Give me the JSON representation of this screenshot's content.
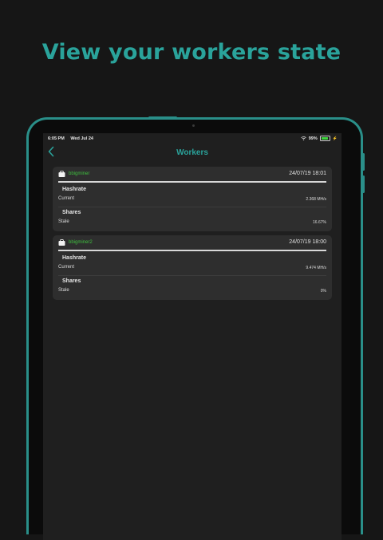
{
  "headline": "View your workers state",
  "status_bar": {
    "time": "6:05 PM",
    "date": "Wed Jul 24",
    "battery": "99%"
  },
  "nav": {
    "title": "Workers",
    "back_icon": "chevron-left-icon"
  },
  "colors": {
    "accent": "#2aa39b",
    "worker_name": "#3fbf3f",
    "card_bg": "#2e2e2e",
    "screen_bg": "#1f1f1f"
  },
  "workers": [
    {
      "name": "bbigminer",
      "time": "24/07/19 18:01",
      "hashrate_title": "Hashrate",
      "current_label": "Current",
      "current_value": "2.368 MH/s",
      "shares_title": "Shares",
      "stale_label": "Stale",
      "stale_value": "16.67%"
    },
    {
      "name": "bbigminer2",
      "time": "24/07/19 18:00",
      "hashrate_title": "Hashrate",
      "current_label": "Current",
      "current_value": "9.474 MH/s",
      "shares_title": "Shares",
      "stale_label": "Stale",
      "stale_value": "0%"
    }
  ]
}
